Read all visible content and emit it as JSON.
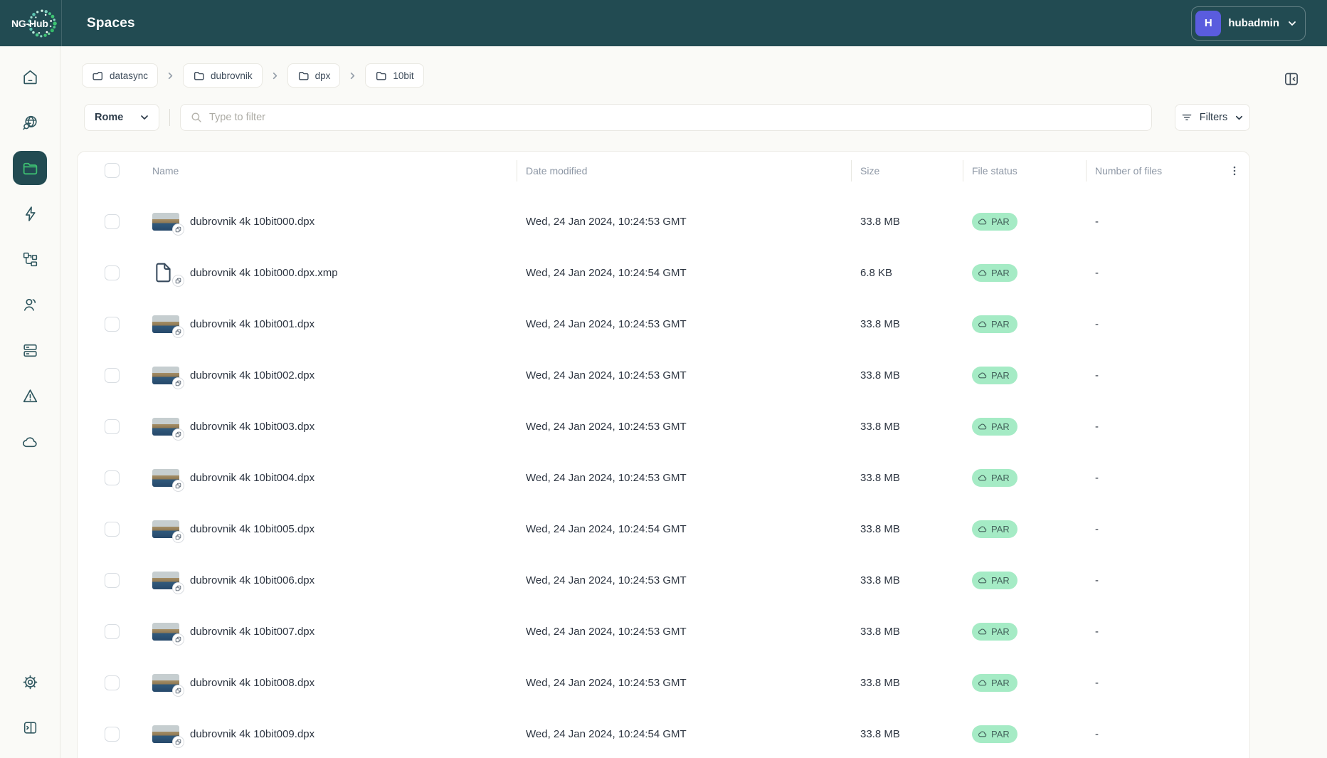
{
  "colors": {
    "header_bg": "#224B52",
    "accent_green": "#3DBE71",
    "avatar_purple": "#5A5CDE",
    "badge_bg": "#A5EBC5",
    "badge_text": "#44635C"
  },
  "header": {
    "logo_text": "NG-Hub",
    "title": "Spaces",
    "user": {
      "initial": "H",
      "name": "hubadmin"
    }
  },
  "sidebar": {
    "items": [
      {
        "icon": "home-icon",
        "active": false
      },
      {
        "icon": "discover-globe-icon",
        "active": false
      },
      {
        "icon": "spaces-folder-icon",
        "active": true
      },
      {
        "icon": "activity-lightning-icon",
        "active": false
      },
      {
        "icon": "workflows-icon",
        "active": false
      },
      {
        "icon": "users-icon",
        "active": false
      },
      {
        "icon": "storage-icon",
        "active": false
      },
      {
        "icon": "alerts-icon",
        "active": false
      },
      {
        "icon": "cloud-icon",
        "active": false
      },
      {
        "icon": "settings-gear-icon",
        "active": false
      },
      {
        "icon": "expand-panel-icon",
        "active": false
      }
    ]
  },
  "breadcrumb": {
    "items": [
      "datasync",
      "dubrovnik",
      "dpx",
      "10bit"
    ]
  },
  "toolbar": {
    "location_value": "Rome",
    "search_placeholder": "Type to filter",
    "filters_label": "Filters"
  },
  "table": {
    "columns": [
      "Name",
      "Date modified",
      "Size",
      "File status",
      "Number of files"
    ],
    "rows": [
      {
        "name": "dubrovnik 4k 10bit000.dpx",
        "type": "image",
        "date": "Wed, 24 Jan 2024, 10:24:53 GMT",
        "size": "33.8 MB",
        "status": "PAR",
        "files": "-"
      },
      {
        "name": "dubrovnik 4k 10bit000.dpx.xmp",
        "type": "document",
        "date": "Wed, 24 Jan 2024, 10:24:54 GMT",
        "size": "6.8 KB",
        "status": "PAR",
        "files": "-"
      },
      {
        "name": "dubrovnik 4k 10bit001.dpx",
        "type": "image",
        "date": "Wed, 24 Jan 2024, 10:24:53 GMT",
        "size": "33.8 MB",
        "status": "PAR",
        "files": "-"
      },
      {
        "name": "dubrovnik 4k 10bit002.dpx",
        "type": "image",
        "date": "Wed, 24 Jan 2024, 10:24:53 GMT",
        "size": "33.8 MB",
        "status": "PAR",
        "files": "-"
      },
      {
        "name": "dubrovnik 4k 10bit003.dpx",
        "type": "image",
        "date": "Wed, 24 Jan 2024, 10:24:53 GMT",
        "size": "33.8 MB",
        "status": "PAR",
        "files": "-"
      },
      {
        "name": "dubrovnik 4k 10bit004.dpx",
        "type": "image",
        "date": "Wed, 24 Jan 2024, 10:24:53 GMT",
        "size": "33.8 MB",
        "status": "PAR",
        "files": "-"
      },
      {
        "name": "dubrovnik 4k 10bit005.dpx",
        "type": "image",
        "date": "Wed, 24 Jan 2024, 10:24:54 GMT",
        "size": "33.8 MB",
        "status": "PAR",
        "files": "-"
      },
      {
        "name": "dubrovnik 4k 10bit006.dpx",
        "type": "image",
        "date": "Wed, 24 Jan 2024, 10:24:53 GMT",
        "size": "33.8 MB",
        "status": "PAR",
        "files": "-"
      },
      {
        "name": "dubrovnik 4k 10bit007.dpx",
        "type": "image",
        "date": "Wed, 24 Jan 2024, 10:24:53 GMT",
        "size": "33.8 MB",
        "status": "PAR",
        "files": "-"
      },
      {
        "name": "dubrovnik 4k 10bit008.dpx",
        "type": "image",
        "date": "Wed, 24 Jan 2024, 10:24:53 GMT",
        "size": "33.8 MB",
        "status": "PAR",
        "files": "-"
      },
      {
        "name": "dubrovnik 4k 10bit009.dpx",
        "type": "image",
        "date": "Wed, 24 Jan 2024, 10:24:54 GMT",
        "size": "33.8 MB",
        "status": "PAR",
        "files": "-"
      }
    ]
  }
}
